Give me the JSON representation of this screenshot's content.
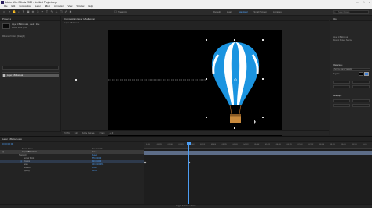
{
  "window": {
    "title": "Adobe After Effects 2020 - Untitled Project.aep",
    "minimize_glyph": "—",
    "maximize_glyph": "☐",
    "close_glyph": "✕"
  },
  "menu": [
    "File",
    "Edit",
    "Composition",
    "Layer",
    "Effect",
    "Animation",
    "View",
    "Window",
    "Help"
  ],
  "toolbar": {
    "snapping_label": "Snapping",
    "workspaces": [
      "Default",
      "Learn",
      "Standard",
      "Small Screen",
      "Libraries"
    ],
    "active_workspace": "Standard",
    "search_placeholder": "Search Help"
  },
  "project": {
    "tab_label": "Project ≡",
    "item_info": "Layer 1 Balloon.ai ▾ , used 1 time",
    "item_info2": "1050 x 1000 (1.00)",
    "item_info3": "Millions of Colors (Straight)",
    "item_name": "Layer 1/Balloon.ai"
  },
  "composition": {
    "tab_label": "Composition Layer 1/Balloon.ai",
    "breadcrumb": "Layer 1/Balloon.ai",
    "footer": [
      "72.2%",
      "Full",
      "Active Camera",
      "1 View",
      "+0.0"
    ]
  },
  "right_panel": {
    "info_label": "Info",
    "layer_label": "Layer 1 Balloon.ai",
    "layer_sub": "Missing Project Source",
    "character_label": "Character ≡",
    "font_label": "Source Sans Variable",
    "style_label": "Regular",
    "paragraph_label": "Paragraph"
  },
  "timeline": {
    "tab_label": "Layer 1/Balloon.ai ≡",
    "timecode": "0:00:00:00",
    "col_source": "Source Name",
    "col_parent": "Parent & Link",
    "layer_name": "Layer 1/Balloon.ai",
    "layer_parent": "None",
    "properties": [
      {
        "name": "Transform",
        "value": "Reset"
      },
      {
        "name": "Anchor Point",
        "value": "525.0,500.0"
      },
      {
        "name": "Position",
        "value": "960.0,540.0"
      },
      {
        "name": "Scale",
        "value": "100.0,100.0%"
      },
      {
        "name": "Rotation",
        "value": "0x+0.0°"
      },
      {
        "name": "Opacity",
        "value": "100%"
      }
    ],
    "ruler_ticks": [
      "0:00f",
      "00:12f",
      "01:00f",
      "01:12f",
      "02:00f",
      "02:12f",
      "03:00f",
      "03:12f",
      "04:00f",
      "04:12f",
      "05:00f",
      "05:12f",
      "06:00f",
      "06:12f",
      "07:00f",
      "07:12f",
      "08:00f",
      "08:12f",
      "09:00f",
      "09:12f",
      "10:0"
    ],
    "footer": "Toggle Switches / Modes"
  }
}
